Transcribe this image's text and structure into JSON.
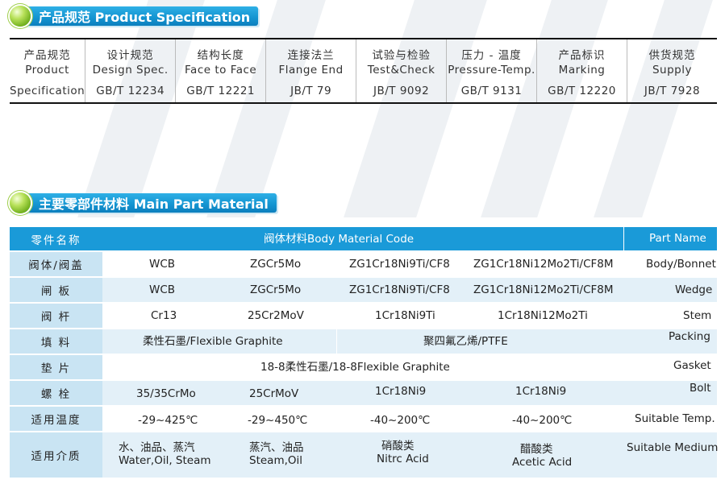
{
  "sections": {
    "spec_title": "产品规范 Product Specification",
    "material_title": "主要零部件材料 Main Part Material"
  },
  "spec": {
    "columns": [
      {
        "zh": "产品规范",
        "en": "Product",
        "std": "Specification"
      },
      {
        "zh": "设计规范",
        "en": "Design Spec.",
        "std": "GB/T 12234"
      },
      {
        "zh": "结构长度",
        "en": "Face to Face",
        "std": "GB/T 12221"
      },
      {
        "zh": "连接法兰",
        "en": "Flange End",
        "std": "JB/T 79"
      },
      {
        "zh": "试验与检验",
        "en": "Test&Check",
        "std": "JB/T 9092"
      },
      {
        "zh": "压力 - 温度",
        "en": "Pressure-Temp.",
        "std": "GB/T 9131"
      },
      {
        "zh": "产品标识",
        "en": "Marking",
        "std": "GB/T 12220"
      },
      {
        "zh": "供货规范",
        "en": "Supply",
        "std": "JB/T 7928"
      }
    ]
  },
  "material": {
    "header": {
      "label": "零件名称",
      "code": "阀体材料Body  Material  Code",
      "part": "Part  Name"
    },
    "rows": [
      {
        "label": "阀体/阀盖",
        "c1": "WCB",
        "c2": "ZGCr5Mo",
        "c3": "ZG1Cr18Ni9Ti/CF8",
        "c4": "ZG1Cr18Ni12Mo2Ti/CF8M",
        "part": "Body/Bonnet"
      },
      {
        "label": "闸  板",
        "c1": "WCB",
        "c2": "ZGCr5Mo",
        "c3": "ZG1Cr18Ni9Ti/CF8",
        "c4": "ZG1Cr18Ni12Mo2Ti/CF8M",
        "part": "Wedge"
      },
      {
        "label": "阀  杆",
        "c1": "Cr13",
        "c2": "25Cr2MoV",
        "c3": "1Cr18Ni9Ti",
        "c4": "1Cr18Ni12Mo2Ti",
        "part": "Stem"
      },
      {
        "label": "填  料",
        "c12": "柔性石墨/Flexible Graphite",
        "c34": "聚四氟乙烯/PTFE",
        "part": "Packing"
      },
      {
        "label": "垫  片",
        "call": "18-8柔性石墨/18-8Flexible  Graphite",
        "part": "Gasket"
      },
      {
        "label": "螺  栓",
        "c1": "35/35CrMo",
        "c2": "25CrMoV",
        "c3": "1Cr18Ni9",
        "c4": "1Cr18Ni9",
        "part": "Bolt"
      },
      {
        "label": "适用温度",
        "c1": "-29~425℃",
        "c2": "-29~450℃",
        "c3": "-40~200℃",
        "c4": "-40~200℃",
        "part": "Suitable Temp."
      },
      {
        "label": "适用介质",
        "c1a": "水、油品、蒸汽",
        "c1b": "Water,Oil, Steam",
        "c2a": "蒸汽、油品",
        "c2b": "Steam,Oil",
        "c3a": "硝酸类",
        "c3b": "Nitrc Acid",
        "c4a": "醋酸类",
        "c4b": "Acetic Acid",
        "part": "Suitable Medium"
      }
    ]
  }
}
